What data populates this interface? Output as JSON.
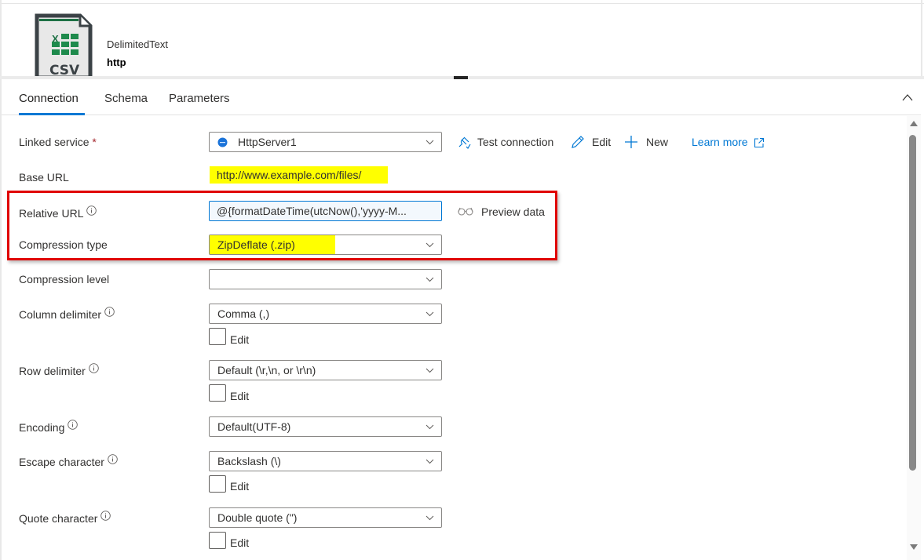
{
  "header": {
    "icon": "csv-file-icon",
    "icon_text": "CSV",
    "dataset_type": "DelimitedText",
    "dataset_name": "http"
  },
  "tabs": [
    {
      "label": "Connection",
      "active": true
    },
    {
      "label": "Schema",
      "active": false
    },
    {
      "label": "Parameters",
      "active": false
    }
  ],
  "colors": {
    "accent": "#0078d4",
    "highlight": "#ffff00",
    "annotation_box": "#e00000",
    "required": "#a4262c"
  },
  "form": {
    "linked_service": {
      "label": "Linked service",
      "required_mark": "*",
      "value": "HttpServer1",
      "icon": "http-globe-icon",
      "actions": {
        "test_connection": "Test connection",
        "edit": "Edit",
        "new": "New",
        "learn_more": "Learn more"
      }
    },
    "base_url": {
      "label": "Base URL",
      "value": "http://www.example.com/files/"
    },
    "relative_url": {
      "label": "Relative URL",
      "value": "@{formatDateTime(utcNow(),'yyyy-M...",
      "preview": "Preview data"
    },
    "compression_type": {
      "label": "Compression type",
      "value": "ZipDeflate (.zip)"
    },
    "compression_level": {
      "label": "Compression level",
      "value": ""
    },
    "column_delimiter": {
      "label": "Column delimiter",
      "value": "Comma (,)",
      "edit_label": "Edit",
      "edit_checked": false
    },
    "row_delimiter": {
      "label": "Row delimiter",
      "value": "Default (\\r,\\n, or \\r\\n)",
      "edit_label": "Edit",
      "edit_checked": false
    },
    "encoding": {
      "label": "Encoding",
      "value": "Default(UTF-8)"
    },
    "escape_character": {
      "label": "Escape character",
      "value": "Backslash (\\)",
      "edit_label": "Edit",
      "edit_checked": false
    },
    "quote_character": {
      "label": "Quote character",
      "value": "Double quote (\")",
      "edit_label": "Edit",
      "edit_checked": false
    }
  }
}
